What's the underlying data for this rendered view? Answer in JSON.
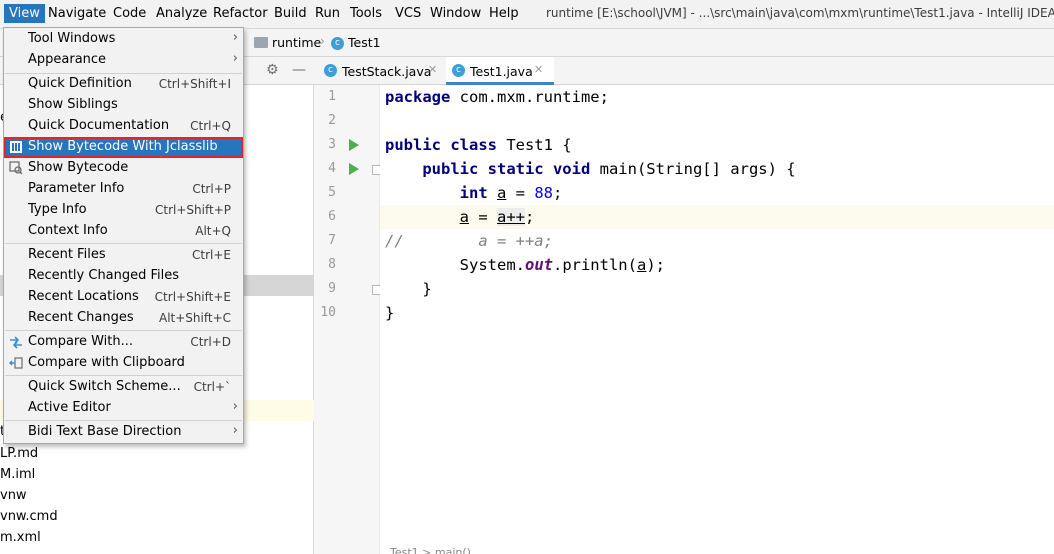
{
  "menubar": {
    "items": [
      "View",
      "Navigate",
      "Code",
      "Analyze",
      "Refactor",
      "Build",
      "Run",
      "Tools",
      "VCS",
      "Window",
      "Help"
    ],
    "window_title": "runtime [E:\\school\\JVM] - ...\\src\\main\\java\\com\\mxm\\runtime\\Test1.java - IntelliJ IDEA ("
  },
  "navbar": {
    "crumbs": [
      "runtime",
      "Test1"
    ]
  },
  "project_tree": {
    "rows": [
      "e",
      "t",
      "LP.md",
      "M.iml",
      "vnw",
      "vnw.cmd",
      "m.xml"
    ]
  },
  "editor": {
    "tabs": [
      "TestStack.java",
      "Test1.java"
    ],
    "selected_tab": "Test1.java",
    "line_numbers": [
      "1",
      "2",
      "3",
      "4",
      "5",
      "6",
      "7",
      "8",
      "9",
      "10"
    ],
    "code": {
      "l1_kw": "package",
      "l1_rest": " com.mxm.runtime;",
      "l3_kw": "public class",
      "l3_rest": " Test1 {",
      "l4_kw": "public static void",
      "l4_rest": " main(String[] args) {",
      "l5_kw": "int",
      "l5_var": "a",
      "l5_eq": " = ",
      "l5_num": "88",
      "l5_end": ";",
      "l6_var": "a",
      "l6_eq": " = ",
      "l6_expr": "a++",
      "l6_end": ";",
      "l7_comment": "//        a = ++a;",
      "l8_pre": "System.",
      "l8_field": "out",
      "l8_mid": ".println(",
      "l8_var": "a",
      "l8_end": ");",
      "l9": "}",
      "l10": "}"
    },
    "status_fragment": "Test1 > main()"
  },
  "view_menu": {
    "items": [
      {
        "label": "Tool Windows",
        "shortcut": "",
        "submenu": true
      },
      {
        "label": "Appearance",
        "shortcut": "",
        "submenu": true
      },
      {
        "label": "Quick Definition",
        "shortcut": "Ctrl+Shift+I",
        "submenu": false
      },
      {
        "label": "Show Siblings",
        "shortcut": "",
        "submenu": false
      },
      {
        "label": "Quick Documentation",
        "shortcut": "Ctrl+Q",
        "submenu": false
      },
      {
        "label": "Show Bytecode With Jclasslib",
        "shortcut": "",
        "submenu": false
      },
      {
        "label": "Show Bytecode",
        "shortcut": "",
        "submenu": false
      },
      {
        "label": "Parameter Info",
        "shortcut": "Ctrl+P",
        "submenu": false
      },
      {
        "label": "Type Info",
        "shortcut": "Ctrl+Shift+P",
        "submenu": false
      },
      {
        "label": "Context Info",
        "shortcut": "Alt+Q",
        "submenu": false
      },
      {
        "label": "Recent Files",
        "shortcut": "Ctrl+E",
        "submenu": false
      },
      {
        "label": "Recently Changed Files",
        "shortcut": "",
        "submenu": false
      },
      {
        "label": "Recent Locations",
        "shortcut": "Ctrl+Shift+E",
        "submenu": false
      },
      {
        "label": "Recent Changes",
        "shortcut": "Alt+Shift+C",
        "submenu": false
      },
      {
        "label": "Compare With...",
        "shortcut": "Ctrl+D",
        "submenu": false
      },
      {
        "label": "Compare with Clipboard",
        "shortcut": "",
        "submenu": false
      },
      {
        "label": "Quick Switch Scheme...",
        "shortcut": "Ctrl+`",
        "submenu": false
      },
      {
        "label": "Active Editor",
        "shortcut": "",
        "submenu": true
      },
      {
        "label": "Bidi Text Base Direction",
        "shortcut": "",
        "submenu": true
      }
    ],
    "highlighted": "Show Bytecode With Jclasslib"
  },
  "colors": {
    "menu_highlight": "#2675bf",
    "highlight_border": "#e0262b",
    "keyword": "#000080",
    "number": "#0000ff",
    "comment": "#808080",
    "static_field": "#660e7a",
    "run_gutter": "#4caf50"
  },
  "icons": [
    "folder-icon",
    "class-icon",
    "gear-icon",
    "minimize-icon",
    "run-icon",
    "fold-icon",
    "bytecode-icon",
    "jclasslib-icon",
    "compare-icon",
    "clipboard-icon",
    "close-icon",
    "submenu-arrow-icon"
  ]
}
